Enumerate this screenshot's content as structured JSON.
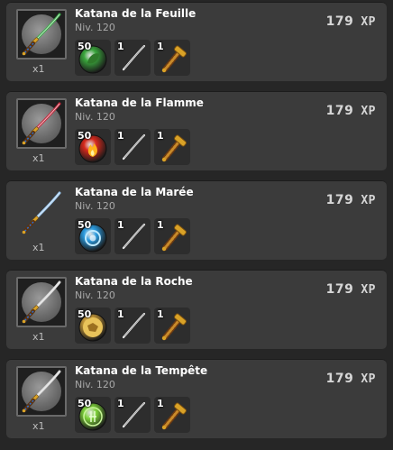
{
  "items": [
    {
      "name": "Katana de la Feuille",
      "level": "Niv. 120",
      "qty": "x1",
      "xp": "179",
      "xp_unit": "XP",
      "ingredients": [
        "50",
        "1",
        "1"
      ],
      "element": "leaf",
      "blade_color": "#3cae4a",
      "orb_color": "#3aa63c",
      "framed": true
    },
    {
      "name": "Katana de la Flamme",
      "level": "Niv. 120",
      "qty": "x1",
      "xp": "179",
      "xp_unit": "XP",
      "ingredients": [
        "50",
        "1",
        "1"
      ],
      "element": "flame",
      "blade_color": "#c8283c",
      "orb_color": "#d6281c",
      "framed": true
    },
    {
      "name": "Katana de la Marée",
      "level": "Niv. 120",
      "qty": "x1",
      "xp": "179",
      "xp_unit": "XP",
      "ingredients": [
        "50",
        "1",
        "1"
      ],
      "element": "tide",
      "blade_color": "#9cc8f0",
      "orb_color": "#2a9be0",
      "framed": false
    },
    {
      "name": "Katana de la Roche",
      "level": "Niv. 120",
      "qty": "x1",
      "xp": "179",
      "xp_unit": "XP",
      "ingredients": [
        "50",
        "1",
        "1"
      ],
      "element": "rock",
      "blade_color": "#d8d8d8",
      "orb_color": "#c89a38",
      "framed": true
    },
    {
      "name": "Katana de la Tempête",
      "level": "Niv. 120",
      "qty": "x1",
      "xp": "179",
      "xp_unit": "XP",
      "ingredients": [
        "50",
        "1",
        "1"
      ],
      "element": "storm",
      "blade_color": "#d8d8d8",
      "orb_color": "#7ed23a",
      "framed": true
    }
  ]
}
